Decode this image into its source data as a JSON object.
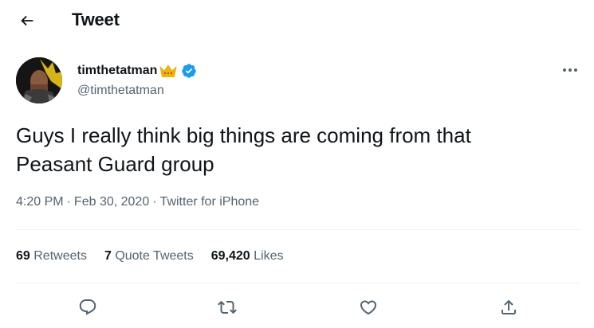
{
  "header": {
    "title": "Tweet",
    "back_icon": "arrow-left-icon"
  },
  "author": {
    "display_name": "timthetatman",
    "handle": "@timthetatman",
    "badge_icon": "crown-icon",
    "verified_icon": "verified-badge-icon",
    "verified_color": "#1d9bf0"
  },
  "more_icon": "more-horizontal-icon",
  "tweet": {
    "text_line1": "Guys I really think big things are coming from that",
    "text_line2": "Peasant Guard group",
    "time": "4:20 PM",
    "separator": "·",
    "date": "Feb 30, 2020",
    "source": "Twitter for iPhone"
  },
  "stats": {
    "retweets_count": "69",
    "retweets_label": "Retweets",
    "quotes_count": "7",
    "quotes_label": "Quote Tweets",
    "likes_count": "69,420",
    "likes_label": "Likes"
  },
  "actions": [
    "reply-icon",
    "retweet-icon",
    "like-icon",
    "share-icon"
  ],
  "colors": {
    "text": "#0f1419",
    "secondary": "#536471",
    "divider": "#eff3f4",
    "accent": "#1d9bf0"
  }
}
